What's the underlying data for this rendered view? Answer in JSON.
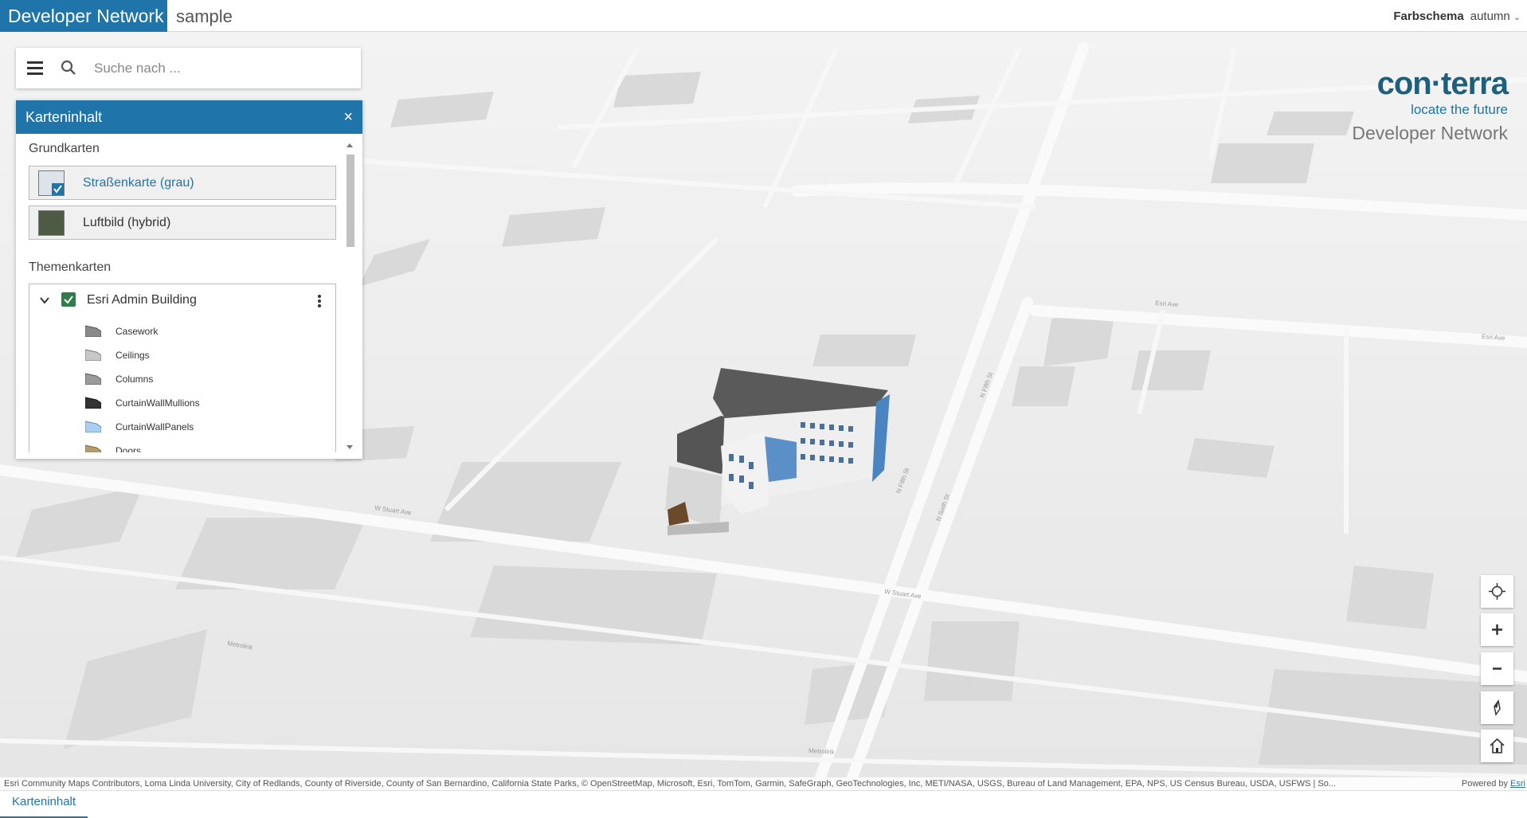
{
  "header": {
    "brand": "Developer Network",
    "app_name": "sample",
    "color_scheme_label": "Farbschema",
    "color_scheme_value": "autumn"
  },
  "search": {
    "placeholder": "Suche nach ..."
  },
  "panel": {
    "title": "Karteninhalt",
    "close": "×",
    "basemaps_title": "Grundkarten",
    "basemaps": [
      {
        "label": "Straßenkarte (grau)",
        "selected": true
      },
      {
        "label": "Luftbild (hybrid)",
        "selected": false
      }
    ],
    "thememaps_title": "Themenkarten",
    "layer": {
      "name": "Esri Admin Building",
      "checked": true,
      "sublayers": [
        {
          "label": "Casework",
          "color": "#8a8a8a"
        },
        {
          "label": "Ceilings",
          "color": "#c8c8c8"
        },
        {
          "label": "Columns",
          "color": "#9a9a9a"
        },
        {
          "label": "CurtainWallMullions",
          "color": "#333333"
        },
        {
          "label": "CurtainWallPanels",
          "color": "#a9cff0"
        },
        {
          "label": "Doors",
          "color": "#b59a6a"
        }
      ]
    }
  },
  "logo": {
    "line1": "con·terra",
    "line2": "locate the future",
    "line3": "Developer Network"
  },
  "map": {
    "street_labels": [
      "W Stuart Ave",
      "W Stuart Ave",
      "Metrolink",
      "Metrolink",
      "N Fifth St",
      "N Fifth St",
      "N Sixth St",
      "Esri Ave",
      "Esri Ave"
    ]
  },
  "controls": [
    "locate-icon",
    "zoom-in-icon",
    "zoom-out-icon",
    "compass-icon",
    "home-icon"
  ],
  "attribution": {
    "text": "Esri Community Maps Contributors, Loma Linda University, City of Redlands, County of Riverside, County of San Bernardino, California State Parks, © OpenStreetMap, Microsoft, Esri, TomTom, Garmin, SafeGraph, GeoTechnologies, Inc, METI/NASA, USGS, Bureau of Land Management, EPA, NPS, US Census Bureau, USDA, USFWS | So...",
    "powered_by": "Powered by",
    "powered_link": "Esri"
  },
  "dock": {
    "tab": "Karteninhalt"
  }
}
